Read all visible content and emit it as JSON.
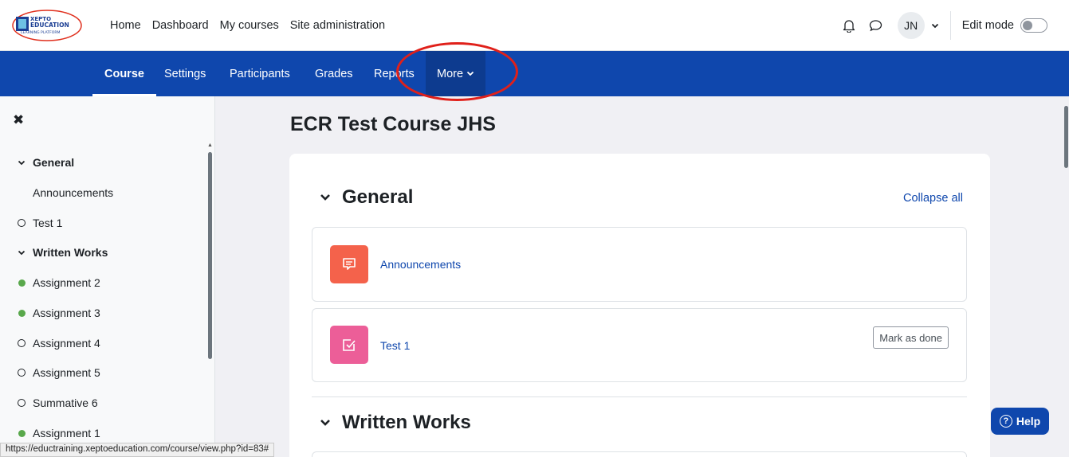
{
  "logo": {
    "line1": "XEPTO",
    "line2": "EDUCATION",
    "line3": "LEARNING PLATFORM"
  },
  "primary_nav": [
    "Home",
    "Dashboard",
    "My courses",
    "Site administration"
  ],
  "user": {
    "initials": "JN"
  },
  "edit_mode_label": "Edit mode",
  "edit_mode_on": false,
  "secondary_nav": {
    "tabs": [
      "Course",
      "Settings",
      "Participants",
      "Grades",
      "Reports"
    ],
    "active": "Course",
    "more_label": "More"
  },
  "drawer": {
    "items": [
      {
        "label": "General",
        "type": "section"
      },
      {
        "label": "Announcements",
        "type": "child"
      },
      {
        "label": "Test 1",
        "type": "incomplete"
      },
      {
        "label": "Written Works",
        "type": "section"
      },
      {
        "label": "Assignment 2",
        "type": "complete"
      },
      {
        "label": "Assignment 3",
        "type": "complete"
      },
      {
        "label": "Assignment 4",
        "type": "incomplete"
      },
      {
        "label": "Assignment 5",
        "type": "incomplete"
      },
      {
        "label": "Summative 6",
        "type": "incomplete"
      },
      {
        "label": "Assignment 1",
        "type": "complete"
      }
    ]
  },
  "status_url": "https://eductraining.xeptoeducation.com/course/view.php?id=83#",
  "course": {
    "title": "ECR Test Course JHS",
    "collapse_all": "Collapse all",
    "sections": [
      {
        "title": "General"
      },
      {
        "title": "Written Works"
      }
    ],
    "activities": [
      {
        "name": "Announcements",
        "icon": "forum-icon",
        "color": "#f4624b"
      },
      {
        "name": "Test 1",
        "icon": "assignment-check-icon",
        "color": "#ec5e98",
        "button": "Mark as done"
      }
    ]
  },
  "help_label": "Help",
  "colors": {
    "brand_blue": "#0f47ad",
    "complete_green": "#59a84b",
    "highlight_red": "#e0201a"
  }
}
